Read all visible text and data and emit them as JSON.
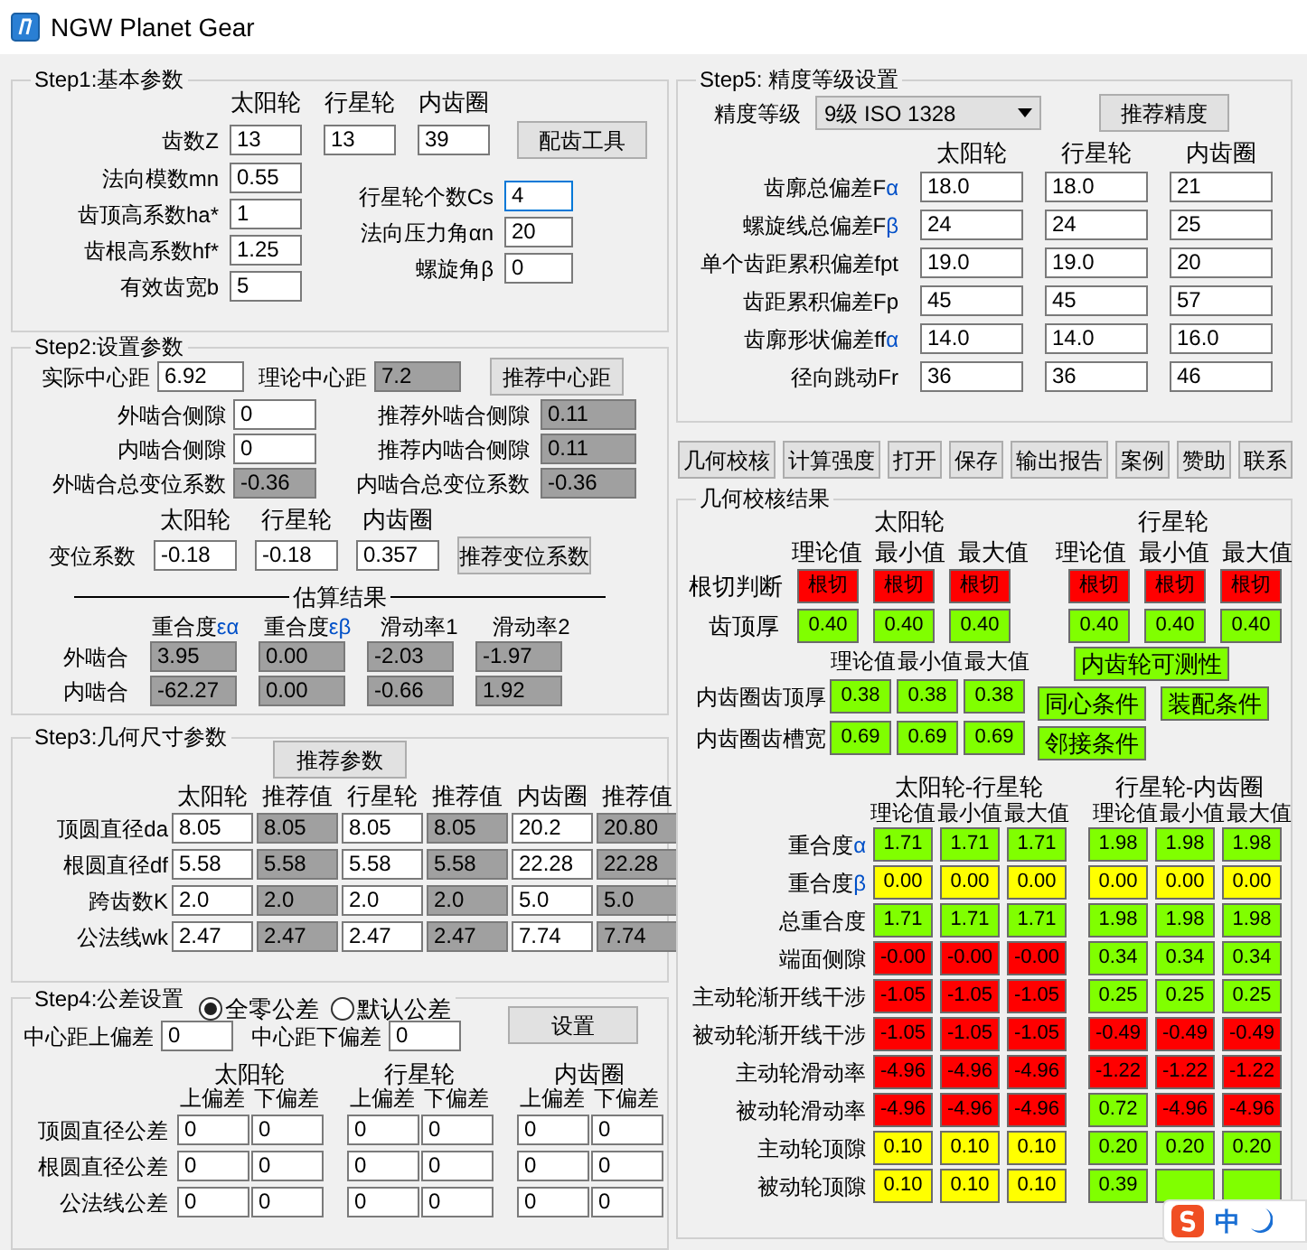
{
  "window": {
    "title": "NGW Planet Gear"
  },
  "step1": {
    "title": "Step1:基本参数",
    "columns": [
      "太阳轮",
      "行星轮",
      "内齿圈"
    ],
    "teeth": {
      "label": "齿数Z",
      "values": [
        "13",
        "13",
        "39"
      ]
    },
    "match_button": "配齿工具",
    "params": [
      {
        "label": "法向模数mn",
        "value": "0.55"
      },
      {
        "label": "齿顶高系数ha*",
        "value": "1"
      },
      {
        "label": "齿根高系数hf*",
        "value": "1.25"
      },
      {
        "label": "有效齿宽b",
        "value": "5"
      }
    ],
    "params_right": [
      {
        "label": "行星轮个数Cs",
        "value": "4",
        "focused": true
      },
      {
        "label": "法向压力角αn",
        "value": "20",
        "focused": false
      },
      {
        "label": "螺旋角β",
        "value": "0",
        "focused": false
      }
    ]
  },
  "step2": {
    "title": "Step2:设置参数",
    "center": {
      "label": "实际中心距",
      "value": "6.92"
    },
    "theory": {
      "label": "理论中心距",
      "value": "7.2"
    },
    "recommend_button": "推荐中心距",
    "backlash_rows": [
      {
        "label": "外啮合侧隙",
        "value": "0",
        "rec_label": "推荐外啮合侧隙",
        "rec_value": "0.11"
      },
      {
        "label": "内啮合侧隙",
        "value": "0",
        "rec_label": "推荐内啮合侧隙",
        "rec_value": "0.11"
      }
    ],
    "total_shift": [
      {
        "label": "外啮合总变位系数",
        "value": "-0.36"
      },
      {
        "label": "内啮合总变位系数",
        "value": "-0.36"
      }
    ],
    "shift": {
      "columns": [
        "太阳轮",
        "行星轮",
        "内齿圈"
      ],
      "label": "变位系数",
      "values": [
        "-0.18",
        "-0.18",
        "0.357"
      ],
      "button": "推荐变位系数"
    },
    "estimate": {
      "title": "估算结果",
      "columns": [
        {
          "label": "重合度",
          "symbol": "εα"
        },
        {
          "label": "重合度",
          "symbol": "εβ"
        },
        {
          "label": "滑动率1"
        },
        {
          "label": "滑动率2"
        }
      ],
      "rows": [
        {
          "label": "外啮合",
          "values": [
            "3.95",
            "0.00",
            "-2.03",
            "-1.97"
          ]
        },
        {
          "label": "内啮合",
          "values": [
            "-62.27",
            "0.00",
            "-0.66",
            "1.92"
          ]
        }
      ]
    }
  },
  "step3": {
    "title": "Step3:几何尺寸参数",
    "button": "推荐参数",
    "columns": [
      "太阳轮",
      "推荐值",
      "行星轮",
      "推荐值",
      "内齿圈",
      "推荐值"
    ],
    "rows": [
      {
        "label": "顶圆直径da",
        "values": [
          "8.05",
          "8.05",
          "8.05",
          "8.05",
          "20.2",
          "20.80"
        ]
      },
      {
        "label": "根圆直径df",
        "values": [
          "5.58",
          "5.58",
          "5.58",
          "5.58",
          "22.28",
          "22.28"
        ]
      },
      {
        "label": "跨齿数K",
        "values": [
          "2.0",
          "2.0",
          "2.0",
          "2.0",
          "5.0",
          "5.0"
        ]
      },
      {
        "label": "公法线wk",
        "values": [
          "2.47",
          "2.47",
          "2.47",
          "2.47",
          "7.74",
          "7.74"
        ]
      }
    ]
  },
  "step4": {
    "title": "Step4:公差设置",
    "modes": [
      {
        "label": "全零公差",
        "selected": true
      },
      {
        "label": "默认公差",
        "selected": false
      }
    ],
    "center_upper": {
      "label": "中心距上偏差",
      "value": "0"
    },
    "center_lower": {
      "label": "中心距下偏差",
      "value": "0"
    },
    "button": "设置",
    "gears": [
      "太阳轮",
      "行星轮",
      "内齿圈"
    ],
    "deviations": [
      "上偏差",
      "下偏差",
      "上偏差",
      "下偏差",
      "上偏差",
      "下偏差"
    ],
    "rows": [
      {
        "label": "顶圆直径公差",
        "values": [
          "0",
          "0",
          "0",
          "0",
          "0",
          "0"
        ]
      },
      {
        "label": "根圆直径公差",
        "values": [
          "0",
          "0",
          "0",
          "0",
          "0",
          "0"
        ]
      },
      {
        "label": "公法线公差",
        "values": [
          "0",
          "0",
          "0",
          "0",
          "0",
          "0"
        ]
      }
    ]
  },
  "step5": {
    "title": "Step5: 精度等级设置",
    "grade": {
      "label": "精度等级",
      "value": "9级 ISO 1328"
    },
    "button": "推荐精度",
    "columns": [
      "太阳轮",
      "行星轮",
      "内齿圈"
    ],
    "rows": [
      {
        "label": "齿廓总偏差F",
        "symbol": "α",
        "values": [
          "18.0",
          "18.0",
          "21"
        ]
      },
      {
        "label": "螺旋线总偏差F",
        "symbol": "β",
        "values": [
          "24",
          "24",
          "25"
        ]
      },
      {
        "label": "单个齿距累积偏差fpt",
        "values": [
          "19.0",
          "19.0",
          "20"
        ]
      },
      {
        "label": "齿距累积偏差Fp",
        "values": [
          "45",
          "45",
          "57"
        ]
      },
      {
        "label": "齿廓形状偏差ff",
        "symbol": "α",
        "values": [
          "14.0",
          "14.0",
          "16.0"
        ]
      },
      {
        "label": "径向跳动Fr",
        "values": [
          "36",
          "36",
          "46"
        ]
      }
    ]
  },
  "toolbar": [
    "几何校核",
    "计算强度",
    "打开",
    "保存",
    "输出报告",
    "案例",
    "赞助",
    "联系"
  ],
  "check": {
    "title": "几何校核结果",
    "gear_groups": [
      {
        "name": "太阳轮",
        "columns": [
          "理论值",
          "最小值",
          "最大值"
        ]
      },
      {
        "name": "行星轮",
        "columns": [
          "理论值",
          "最小值",
          "最大值"
        ]
      }
    ],
    "gear_rows": [
      {
        "label": "根切判断",
        "cells": [
          {
            "value": "根切",
            "color": "#ff0000"
          },
          {
            "value": "根切",
            "color": "#ff0000"
          },
          {
            "value": "根切",
            "color": "#ff0000"
          },
          {
            "value": "根切",
            "color": "#ff0000"
          },
          {
            "value": "根切",
            "color": "#ff0000"
          },
          {
            "value": "根切",
            "color": "#ff0000"
          }
        ]
      },
      {
        "label": "齿顶厚",
        "cells": [
          {
            "value": "0.40",
            "color": "#80ff00"
          },
          {
            "value": "0.40",
            "color": "#80ff00"
          },
          {
            "value": "0.40",
            "color": "#80ff00"
          },
          {
            "value": "0.40",
            "color": "#80ff00"
          },
          {
            "value": "0.40",
            "color": "#80ff00"
          },
          {
            "value": "0.40",
            "color": "#80ff00"
          }
        ]
      }
    ],
    "ring_columns": [
      "理论值",
      "最小值",
      "最大值"
    ],
    "ring_rows": [
      {
        "label": "内齿圈齿顶厚",
        "cells": [
          {
            "value": "0.38",
            "color": "#80ff00"
          },
          {
            "value": "0.38",
            "color": "#80ff00"
          },
          {
            "value": "0.38",
            "color": "#80ff00"
          }
        ]
      },
      {
        "label": "内齿圈齿槽宽",
        "cells": [
          {
            "value": "0.69",
            "color": "#80ff00"
          },
          {
            "value": "0.69",
            "color": "#80ff00"
          },
          {
            "value": "0.69",
            "color": "#80ff00"
          }
        ]
      }
    ],
    "conditions": [
      {
        "label": "内齿轮可测性",
        "color": "#80ff00"
      },
      {
        "label": "同心条件",
        "color": "#80ff00"
      },
      {
        "label": "装配条件",
        "color": "#80ff00"
      },
      {
        "label": "邻接条件",
        "color": "#80ff00"
      }
    ],
    "mesh_groups": [
      "太阳轮-行星轮",
      "行星轮-内齿圈"
    ],
    "mesh_columns": [
      "理论值",
      "最小值",
      "最大值",
      "理论值",
      "最小值",
      "最大值"
    ],
    "mesh_rows": [
      {
        "label": "重合度",
        "symbol": "α",
        "cells": [
          {
            "value": "1.71",
            "color": "#80ff00"
          },
          {
            "value": "1.71",
            "color": "#80ff00"
          },
          {
            "value": "1.71",
            "color": "#80ff00"
          },
          {
            "value": "1.98",
            "color": "#80ff00"
          },
          {
            "value": "1.98",
            "color": "#80ff00"
          },
          {
            "value": "1.98",
            "color": "#80ff00"
          }
        ]
      },
      {
        "label": "重合度",
        "symbol": "β",
        "cells": [
          {
            "value": "0.00",
            "color": "#ffff00"
          },
          {
            "value": "0.00",
            "color": "#ffff00"
          },
          {
            "value": "0.00",
            "color": "#ffff00"
          },
          {
            "value": "0.00",
            "color": "#ffff00"
          },
          {
            "value": "0.00",
            "color": "#ffff00"
          },
          {
            "value": "0.00",
            "color": "#ffff00"
          }
        ]
      },
      {
        "label": "总重合度",
        "cells": [
          {
            "value": "1.71",
            "color": "#80ff00"
          },
          {
            "value": "1.71",
            "color": "#80ff00"
          },
          {
            "value": "1.71",
            "color": "#80ff00"
          },
          {
            "value": "1.98",
            "color": "#80ff00"
          },
          {
            "value": "1.98",
            "color": "#80ff00"
          },
          {
            "value": "1.98",
            "color": "#80ff00"
          }
        ]
      },
      {
        "label": "端面侧隙",
        "cells": [
          {
            "value": "-0.00",
            "color": "#ff0000"
          },
          {
            "value": "-0.00",
            "color": "#ff0000"
          },
          {
            "value": "-0.00",
            "color": "#ff0000"
          },
          {
            "value": "0.34",
            "color": "#80ff00"
          },
          {
            "value": "0.34",
            "color": "#80ff00"
          },
          {
            "value": "0.34",
            "color": "#80ff00"
          }
        ]
      },
      {
        "label": "主动轮渐开线干涉",
        "cells": [
          {
            "value": "-1.05",
            "color": "#ff0000"
          },
          {
            "value": "-1.05",
            "color": "#ff0000"
          },
          {
            "value": "-1.05",
            "color": "#ff0000"
          },
          {
            "value": "0.25",
            "color": "#80ff00"
          },
          {
            "value": "0.25",
            "color": "#80ff00"
          },
          {
            "value": "0.25",
            "color": "#80ff00"
          }
        ]
      },
      {
        "label": "被动轮渐开线干涉",
        "cells": [
          {
            "value": "-1.05",
            "color": "#ff0000"
          },
          {
            "value": "-1.05",
            "color": "#ff0000"
          },
          {
            "value": "-1.05",
            "color": "#ff0000"
          },
          {
            "value": "-0.49",
            "color": "#ff0000"
          },
          {
            "value": "-0.49",
            "color": "#ff0000"
          },
          {
            "value": "-0.49",
            "color": "#ff0000"
          }
        ]
      },
      {
        "label": "主动轮滑动率",
        "cells": [
          {
            "value": "-4.96",
            "color": "#ff0000"
          },
          {
            "value": "-4.96",
            "color": "#ff0000"
          },
          {
            "value": "-4.96",
            "color": "#ff0000"
          },
          {
            "value": "-1.22",
            "color": "#ff0000"
          },
          {
            "value": "-1.22",
            "color": "#ff0000"
          },
          {
            "value": "-1.22",
            "color": "#ff0000"
          }
        ]
      },
      {
        "label": "被动轮滑动率",
        "cells": [
          {
            "value": "-4.96",
            "color": "#ff0000"
          },
          {
            "value": "-4.96",
            "color": "#ff0000"
          },
          {
            "value": "-4.96",
            "color": "#ff0000"
          },
          {
            "value": "0.72",
            "color": "#80ff00"
          },
          {
            "value": "-4.96",
            "color": "#ff0000"
          },
          {
            "value": "-4.96",
            "color": "#ff0000"
          }
        ]
      },
      {
        "label": "主动轮顶隙",
        "cells": [
          {
            "value": "0.10",
            "color": "#ffff00"
          },
          {
            "value": "0.10",
            "color": "#ffff00"
          },
          {
            "value": "0.10",
            "color": "#ffff00"
          },
          {
            "value": "0.20",
            "color": "#80ff00"
          },
          {
            "value": "0.20",
            "color": "#80ff00"
          },
          {
            "value": "0.20",
            "color": "#80ff00"
          }
        ]
      },
      {
        "label": "被动轮顶隙",
        "cells": [
          {
            "value": "0.10",
            "color": "#ffff00"
          },
          {
            "value": "0.10",
            "color": "#ffff00"
          },
          {
            "value": "0.10",
            "color": "#ffff00"
          },
          {
            "value": "0.39",
            "color": "#80ff00"
          },
          {
            "color": "#80ff00"
          },
          {
            "color": "#80ff00"
          }
        ]
      }
    ]
  },
  "ime_bar": {
    "label": "中"
  }
}
